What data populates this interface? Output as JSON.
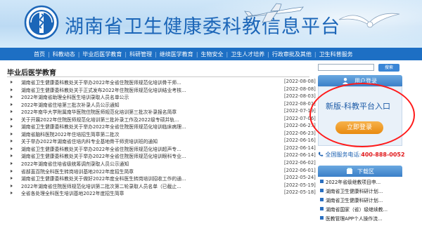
{
  "header": {
    "site_title": "湖南省卫生健康委科教信息平台"
  },
  "nav": {
    "items": [
      "首页",
      "科教动态",
      "毕业后医学教育",
      "科研管理",
      "继续医学教育",
      "生物安全",
      "卫生人才培养",
      "行政审批及其他",
      "卫生科普服务"
    ]
  },
  "main": {
    "section_title": "毕业后医学教育",
    "news": [
      {
        "title": "湖南省卫生健康委科教处关于举办2022年全省住院医师规范化培训骨干师...",
        "date": "[2022-08-08]"
      },
      {
        "title": "湖南省卫生健康委科教处关于正式发布2022年住院医师规范化培训结业考核...",
        "date": "[2022-08-08]"
      },
      {
        "title": "2022年湖南省助理全科医生培训录取人员名单公示",
        "date": "[2022-08-03]"
      },
      {
        "title": "2022年湖南省住培第三批次补录人员公示通知",
        "date": "[2022-08-01]"
      },
      {
        "title": "2022年南华大学附属南华医院住院医师规范化培训第三批次补录报名简章",
        "date": "[2022-07-19]"
      },
      {
        "title": "关于开展2022年住院医师规范化培训第三批补录工作及2022级专硕并轨...",
        "date": "[2022-07-06]"
      },
      {
        "title": "湖南省卫生健康委科教处关于举办2022年全省住院医师规范化培训临床病理...",
        "date": "[2022-06-27]"
      },
      {
        "title": "湖南省脑科医院2022年住培招生简章第二批次",
        "date": "[2022-06-23]"
      },
      {
        "title": "关于举办2022年湖南省住培内科专业基地骨干师资培训班的通知",
        "date": "[2022-06-16]"
      },
      {
        "title": "湖南省卫生健康委科教处关于举办2022年全省住院医师规范化培训超声专...",
        "date": "[2022-06-14]"
      },
      {
        "title": "湖南省卫生健康委科教处关于举办2022年全省住院医师规范化培训眼科专业...",
        "date": "[2022-06-14]"
      },
      {
        "title": "2022年湖南省住培省级统筹调剂录取人员公示通知",
        "date": "[2022-06-02]"
      },
      {
        "title": "省部直百院全科医生转岗培训基地2022年度招生简章",
        "date": "[2022-06-01]"
      },
      {
        "title": "湖南省卫生健康委科教处关于做好2022年度全科医生转岗培训招收工作的通...",
        "date": "[2022-05-24]"
      },
      {
        "title": "2022年湖南省住院医师规范化培训第二批次第二轮录取人员名单（已截止...",
        "date": "[2022-05-19]"
      },
      {
        "title": "全省各处理全科医生培训基地2022年度招生简章",
        "date": "[2022-05-18]"
      }
    ]
  },
  "sidebar": {
    "search_button": "搜索",
    "login_header": "用户登录",
    "platform_entry": "新版-科教平台入口",
    "login_button": "立即登录",
    "phone_label": "全国服务电话:",
    "phone_number": "400-888-0052",
    "download_header": "下载区",
    "downloads": [
      "2022年省级继教项目申...",
      "湖南省卫生健康科研计划...",
      "湖南省卫生健康科研计划...",
      "湖南省国家（省）级继续教...",
      "医教管理APP个人操作流..."
    ]
  },
  "colors": {
    "nav_bg": "#1d6fc4",
    "title_blue": "#1c66b8",
    "highlight_oval": "#ff1a1a",
    "login_button": "#f0a030",
    "phone_red": "#e0181b"
  }
}
